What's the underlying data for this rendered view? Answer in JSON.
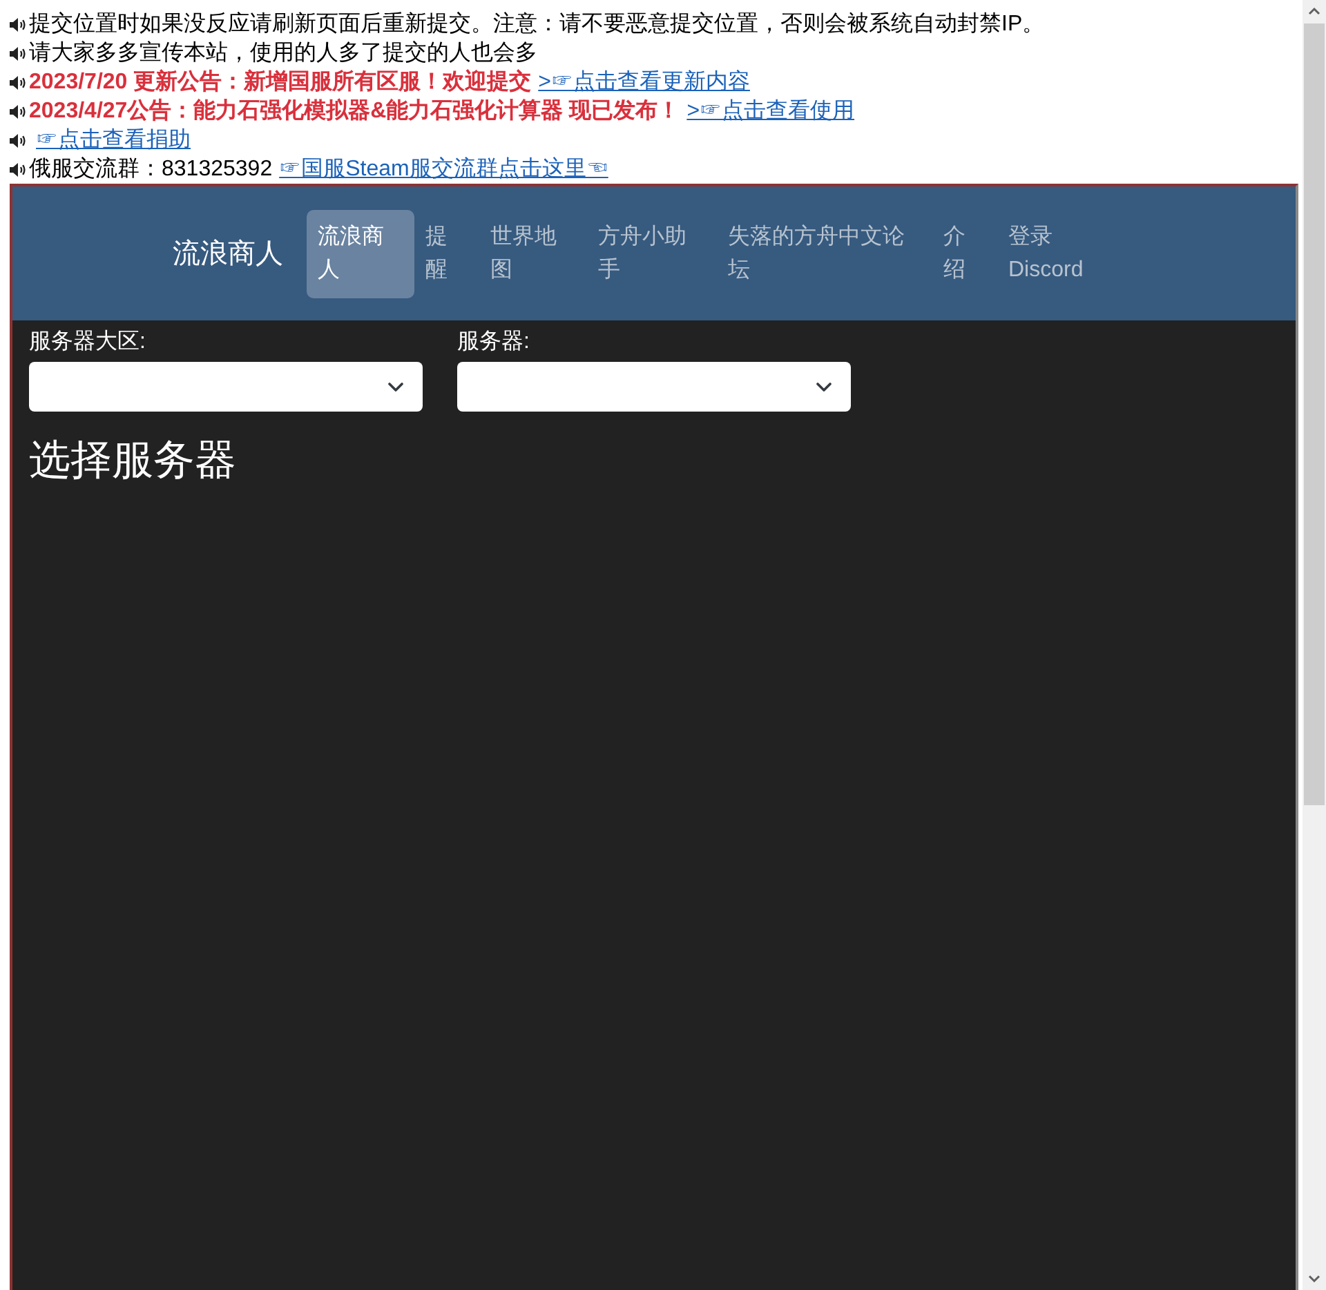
{
  "notices": [
    {
      "kind": "plain",
      "text": "提交位置时如果没反应请刷新页面后重新提交。注意：请不要恶意提交位置，否则会被系统自动封禁IP。"
    },
    {
      "kind": "plain",
      "text": "请大家多多宣传本站，使用的人多了提交的人也会多"
    },
    {
      "kind": "alert",
      "text": "2023/7/20 更新公告：新增国服所有区服！欢迎提交",
      "link": ">☞点击查看更新内容"
    },
    {
      "kind": "alert",
      "text": "2023/4/27公告：能力石强化模拟器&能力石强化计算器 现已发布！",
      "link": ">☞点击查看使用"
    },
    {
      "kind": "plain",
      "link": "☞点击查看捐助"
    },
    {
      "kind": "plain",
      "text": "俄服交流群：831325392",
      "link": "☞国服Steam服交流群点击这里☜"
    }
  ],
  "navbar": {
    "brand": "流浪商人",
    "items": [
      {
        "label": "流浪商人",
        "selected": true
      },
      {
        "label": "提醒",
        "selected": false
      },
      {
        "label": "世界地图",
        "selected": false
      },
      {
        "label": "方舟小助手",
        "selected": false
      },
      {
        "label": "失落的方舟中文论坛",
        "selected": false
      },
      {
        "label": "介绍",
        "selected": false
      },
      {
        "label": "登录 Discord",
        "selected": false
      }
    ]
  },
  "filters": [
    {
      "label": "服务器大区:"
    },
    {
      "label": "服务器:"
    }
  ],
  "heading": "选择服务器"
}
